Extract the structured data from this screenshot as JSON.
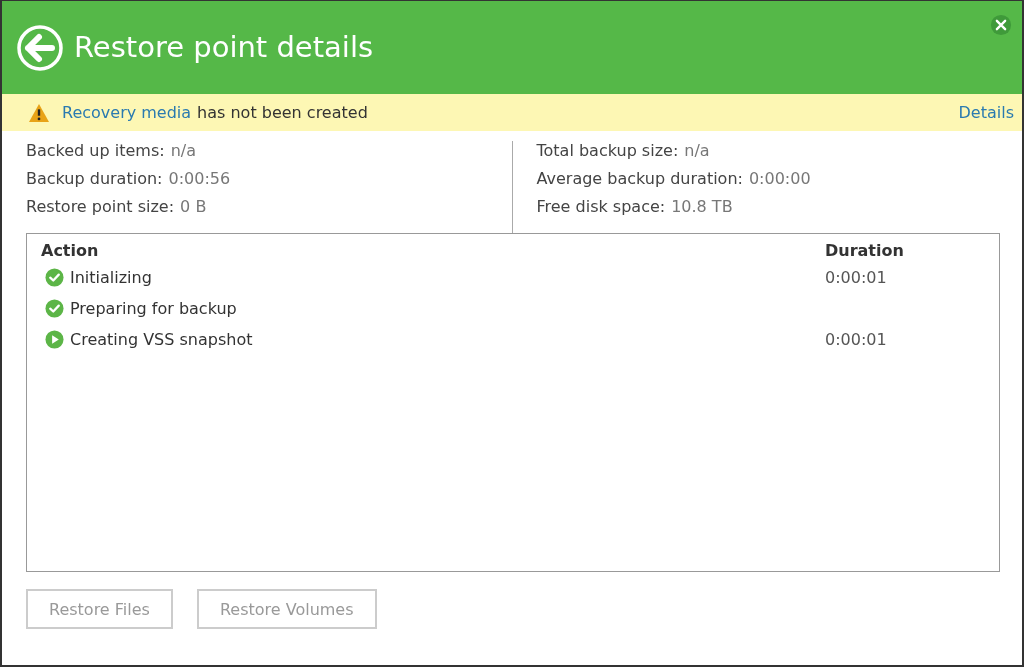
{
  "window": {
    "title": "Restore point details"
  },
  "warning": {
    "link": "Recovery media",
    "text": "has not been created",
    "details": "Details"
  },
  "stats_left": [
    {
      "label": "Backed up items:",
      "value": "n/a"
    },
    {
      "label": "Backup duration:",
      "value": "0:00:56"
    },
    {
      "label": "Restore point size:",
      "value": "0 B"
    }
  ],
  "stats_right": [
    {
      "label": "Total backup size:",
      "value": "n/a"
    },
    {
      "label": "Average backup duration:",
      "value": "0:00:00"
    },
    {
      "label": "Free disk space:",
      "value": "10.8 TB"
    }
  ],
  "table": {
    "columns": [
      "Action",
      "Duration"
    ],
    "rows": [
      {
        "kind": "done",
        "action": "Initializing",
        "duration": "0:00:01"
      },
      {
        "kind": "done",
        "action": "Preparing for backup"
      },
      {
        "kind": "running",
        "action": "Creating VSS snapshot",
        "duration": "0:00:01"
      }
    ]
  },
  "buttons": [
    {
      "label": "Restore Files",
      "disabled": true
    },
    {
      "label": "Restore Volumes",
      "disabled": true
    }
  ]
}
